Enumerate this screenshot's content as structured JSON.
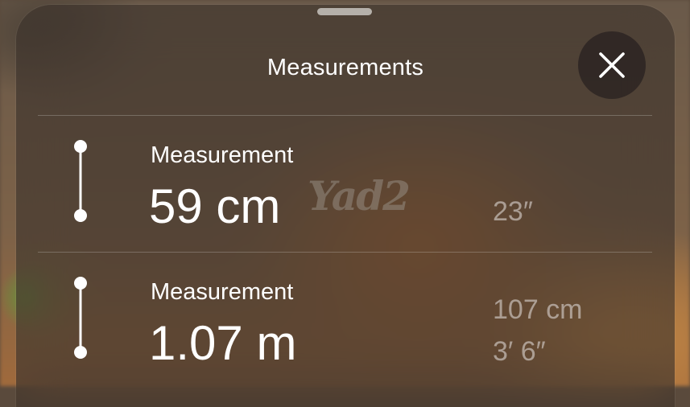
{
  "sheet": {
    "title": "Measurements",
    "close_icon": "close-icon"
  },
  "measurements": [
    {
      "label": "Measurement",
      "value": "59 cm",
      "alt": [
        "23″"
      ]
    },
    {
      "label": "Measurement",
      "value": "1.07 m",
      "alt": [
        "107 cm",
        "3′ 6″"
      ]
    }
  ],
  "watermark": "Yad2"
}
